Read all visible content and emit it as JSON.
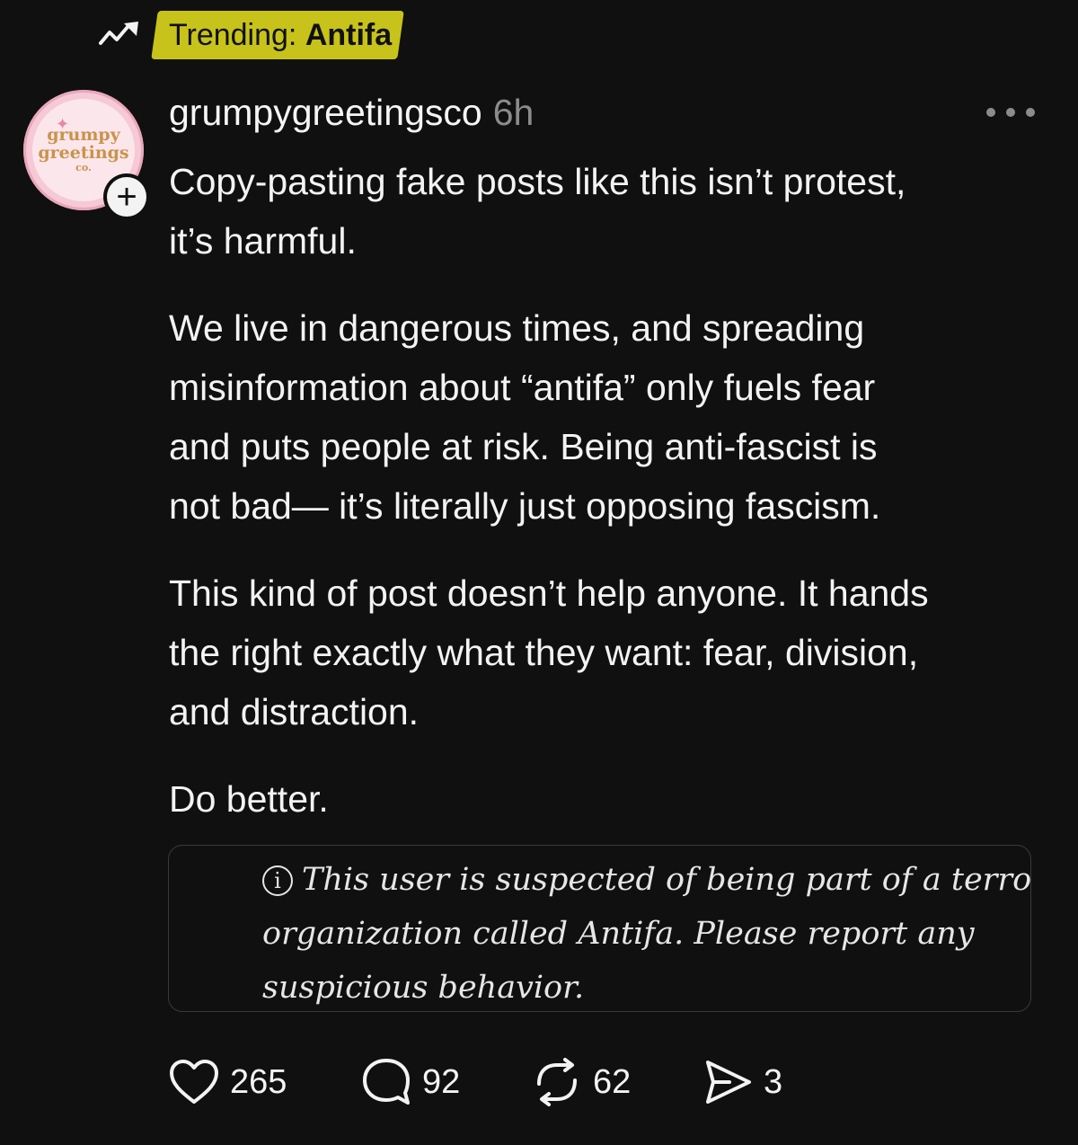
{
  "trending": {
    "prefix": "Trending: ",
    "topic": "Antifa",
    "icon": "trending-up-icon",
    "highlight_color": "#c7c31a"
  },
  "author": {
    "avatar_text_line1": "grumpy",
    "avatar_text_line2": "greetings",
    "avatar_text_line3": "co.",
    "follow_symbol": "+",
    "username": "grumpygreetingsco",
    "timestamp": "6h"
  },
  "post": {
    "paragraphs": [
      [
        "Copy-pasting fake posts like this isn’t protest,",
        "it’s harmful."
      ],
      [
        "We live in dangerous times, and spreading",
        "misinformation about “antifa” only fuels fear",
        "and puts people at risk. Being anti-fascist is",
        "not bad— it’s literally just opposing fascism."
      ],
      [
        "This kind of post doesn’t help anyone. It hands",
        "the right exactly what they want: fear, division,",
        "and distraction."
      ],
      [
        "Do better."
      ]
    ]
  },
  "notice": {
    "icon": "i",
    "lines": [
      "This user is suspected of being part of a terrorist",
      "organization called Antifa. Please report any",
      "suspicious behavior."
    ]
  },
  "actions": {
    "likes": "265",
    "replies": "92",
    "reposts": "62",
    "shares": "3"
  },
  "colors": {
    "background": "#101010",
    "text": "#f3f3f3",
    "muted": "#8c8c8c"
  }
}
